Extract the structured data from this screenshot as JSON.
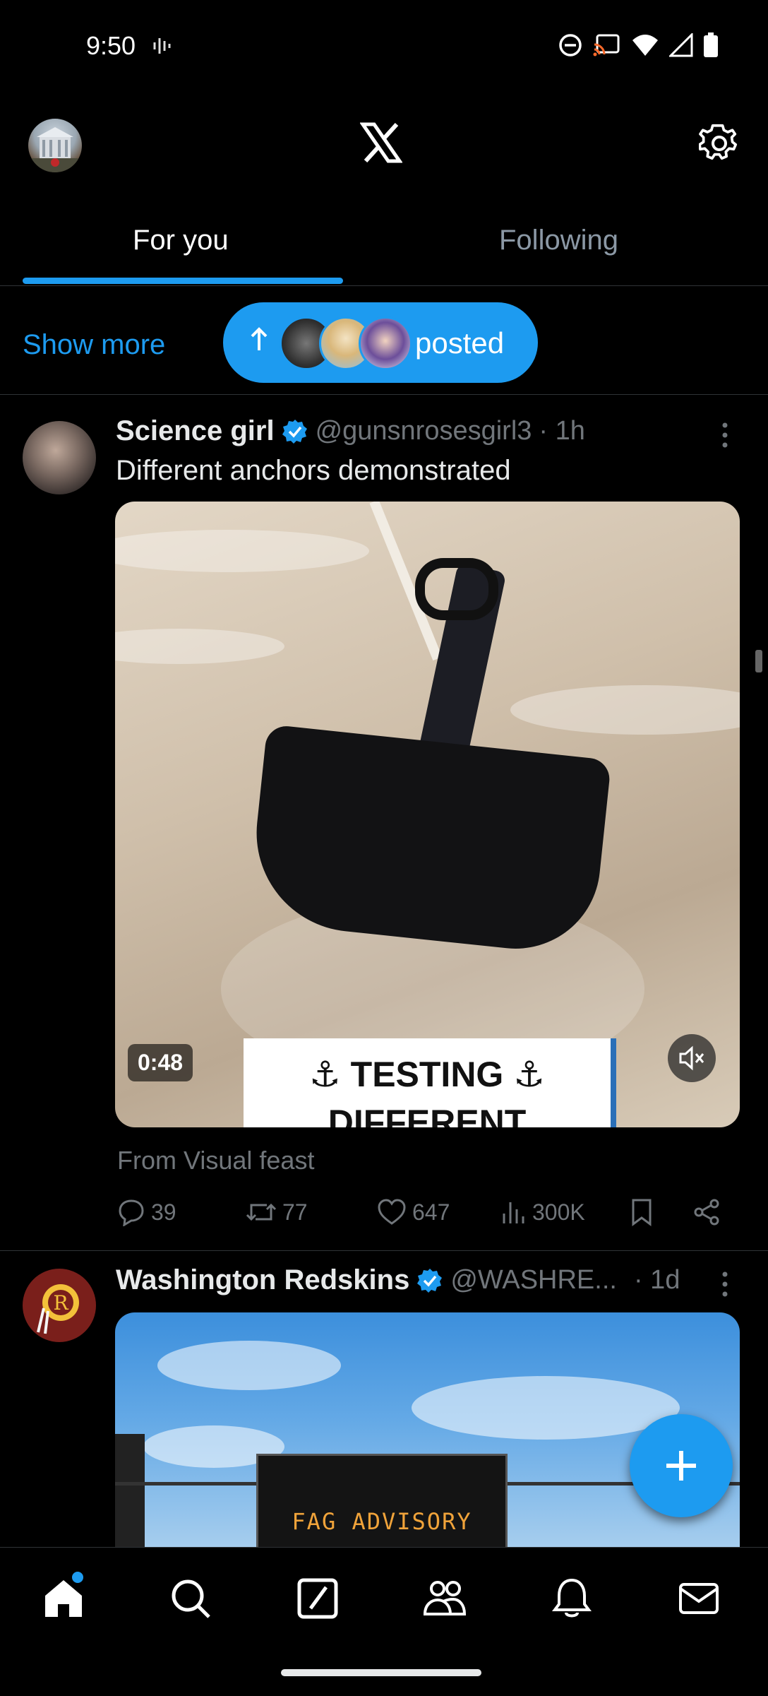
{
  "status_bar": {
    "time": "9:50"
  },
  "tabs": [
    {
      "label": "For you",
      "active": true
    },
    {
      "label": "Following",
      "active": false
    }
  ],
  "new_posts": {
    "show_more": "Show more",
    "label": "posted"
  },
  "tweets": [
    {
      "name": "Science girl",
      "handle": "@gunsnrosesgirl3",
      "time": "· 1h",
      "text": "Different anchors demonstrated",
      "media": {
        "caption_line1": "⚓ TESTING ⚓",
        "caption_line2": "DIFFERENT ANCHORS",
        "duration": "0:48"
      },
      "from": "From Visual feast",
      "stats": {
        "replies": "39",
        "reposts": "77",
        "likes": "647",
        "views": "300K"
      }
    },
    {
      "name": "Washington Redskins",
      "handle": "@WASHRE...",
      "time": "· 1d",
      "media": {
        "sign_text": "FAG ADVISORY"
      }
    }
  ],
  "colors": {
    "accent": "#1d9bf0",
    "background": "#000000",
    "muted": "#71767b"
  },
  "icons": {
    "header": [
      "profile-avatar",
      "x-logo",
      "gear-icon"
    ],
    "nav": [
      "home-icon",
      "search-icon",
      "grok-icon",
      "communities-icon",
      "bell-icon",
      "mail-icon"
    ]
  }
}
